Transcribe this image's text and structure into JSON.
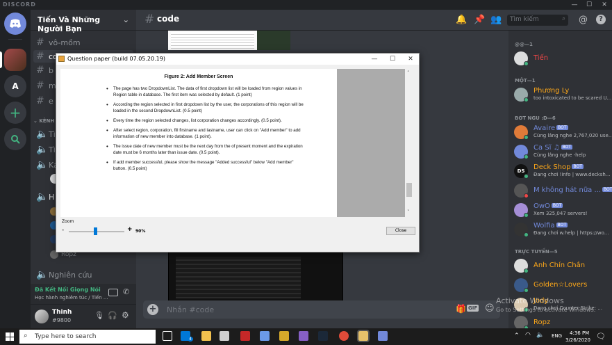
{
  "window": {
    "brand": "DISCORD"
  },
  "guild": {
    "name": "Tiến Và Những Người Bạn",
    "channels": [
      {
        "name": "vô-mồm",
        "type": "text"
      },
      {
        "name": "code",
        "type": "text"
      },
      {
        "name": "b",
        "type": "text"
      },
      {
        "name": "m",
        "type": "text"
      },
      {
        "name": "e",
        "type": "text"
      }
    ],
    "voice_category": "KÊNH Đ",
    "voice_channels": [
      "Tì",
      "Tì",
      "Ká"
    ],
    "voice_user": "Ropz",
    "last_channel": "Nghiên cứu"
  },
  "voice_status": {
    "title": "Đã Kết Nối Giọng Nói",
    "sub": "Học hành nghiêm túc / Tiến ..."
  },
  "user": {
    "name": "Thinh",
    "tag": "#9800"
  },
  "chat": {
    "channel": "code",
    "search_placeholder": "Tìm kiếm",
    "input_placeholder": "Nhắn #code"
  },
  "members": {
    "cat_owner": "@@—1",
    "cat_one": "MỘT—1",
    "cat_bots": "BOT NGU :D—6",
    "cat_online": "TRỰC TUYẾN—5",
    "list": [
      {
        "name": "Tiến",
        "sub": "",
        "color": "#f04747"
      },
      {
        "name": "Phương Ly",
        "sub": "too intoxicated to be scared U...",
        "color": "#faa61a"
      },
      {
        "name": "Avaire",
        "sub": "Cùng lắng nghe 2,767,020 use...",
        "color": "#7289da",
        "bot": true
      },
      {
        "name": "Ca Sĩ ♫",
        "sub": "Cùng lắng nghe -help",
        "color": "#7289da",
        "bot": true
      },
      {
        "name": "Deck Shop",
        "sub": "Đang chơi !info | www.decksh...",
        "color": "#faa61a",
        "bot": true
      },
      {
        "name": "M không hát nữa ...",
        "sub": "",
        "color": "#7289da",
        "bot": true
      },
      {
        "name": "OwO",
        "sub": "Xem 325,047 servers!",
        "color": "#7289da",
        "bot": true
      },
      {
        "name": "Wolfia",
        "sub": "Đang chơi w.help | https://wo...",
        "color": "#7289da",
        "bot": true
      },
      {
        "name": "Anh Chín Chắn",
        "sub": "",
        "color": "#faa61a"
      },
      {
        "name": "Golden☆Lovers",
        "sub": "",
        "color": "#faa61a"
      },
      {
        "name": "Jody",
        "sub": "Đang chơi Counter-Strike: ...",
        "color": "#faa61a"
      },
      {
        "name": "Ropz",
        "sub": "",
        "color": "#faa61a"
      }
    ],
    "bot_label": "BOT"
  },
  "question_paper": {
    "title": "Question paper (build 07.05.20.19)",
    "figure_caption": "Figure 2: Add Member Screen",
    "bullets": [
      "The page has two DropdownList. The data of first dropdown list will be loaded from region values in Region table in database. The first item was selected by default. (1 point)",
      "According the region selected in first dropdown list by the user, the corporations of this region will be loaded in the second DropdownList. (0.5 point)",
      "Every time the region selected changes, list corporation changes accordingly. (0.5 point).",
      "After select region, corporation, fill firstname and lastname, user can click on \"Add member\" to add information of new member into database. (1 point).",
      "The issue date of new member must be the next day from the of present moment and the expiration date must be 6 months later than issue date. (0.5 point).",
      "If add member successful, please show the message \"Added successful\" below \"Add member\" button. (0.5 point)"
    ],
    "zoom_label": "Zoom",
    "zoom_minus": "-",
    "zoom_plus": "+",
    "zoom_value": "90%",
    "zoom_fraction": 0.45,
    "close_label": "Close"
  },
  "activation": {
    "title": "Activate Windows",
    "sub": "Go to Settings to activate Windows."
  },
  "taskbar": {
    "search_placeholder": "Type here to search",
    "lang": "ENG",
    "time": "4:36 PM",
    "date": "3/26/2020",
    "badge": "4"
  }
}
